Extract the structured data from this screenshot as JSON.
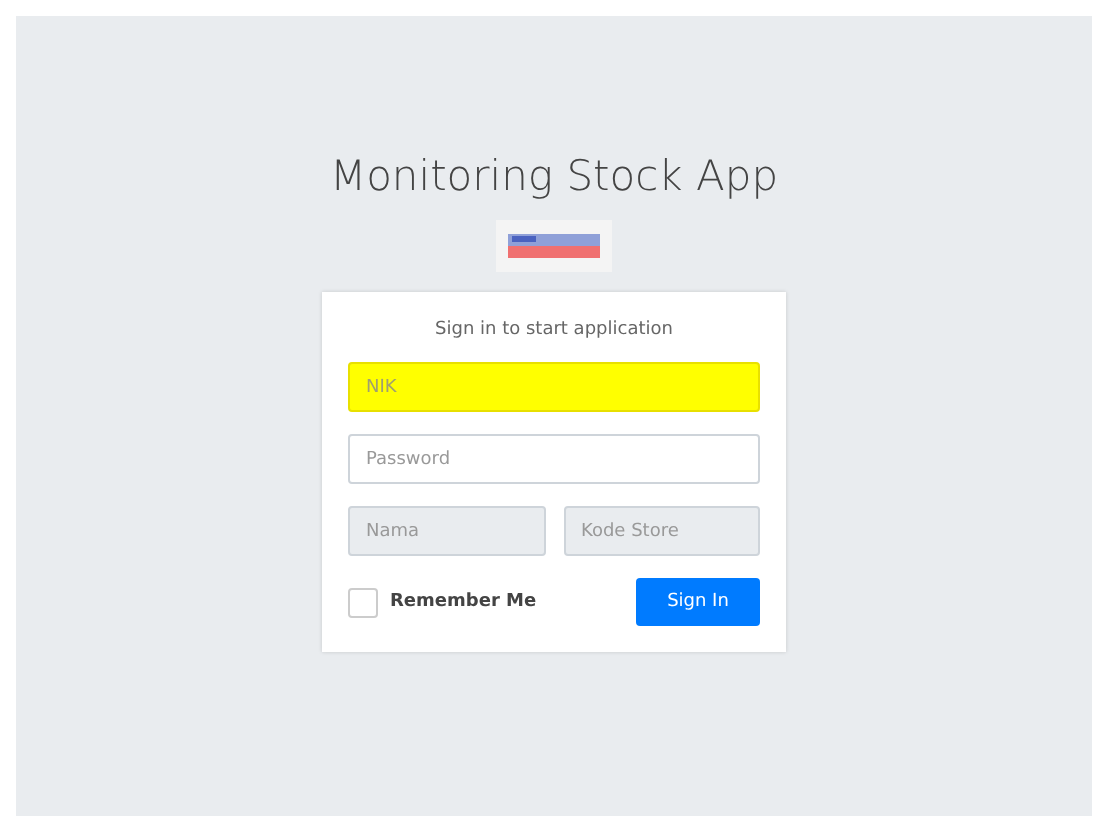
{
  "title": "Monitoring Stock App",
  "login": {
    "message": "Sign in to start application",
    "fields": [
      {
        "placeholder": "NIK",
        "highlighted": true,
        "disabled": false
      },
      {
        "placeholder": "Password",
        "highlighted": false,
        "disabled": false
      }
    ],
    "pair": [
      {
        "placeholder": "Nama",
        "highlighted": false,
        "disabled": true
      },
      {
        "placeholder": "Kode Store",
        "highlighted": false,
        "disabled": true
      }
    ],
    "remember": {
      "label": "Remember Me",
      "checked": false
    },
    "button": "Sign In"
  }
}
